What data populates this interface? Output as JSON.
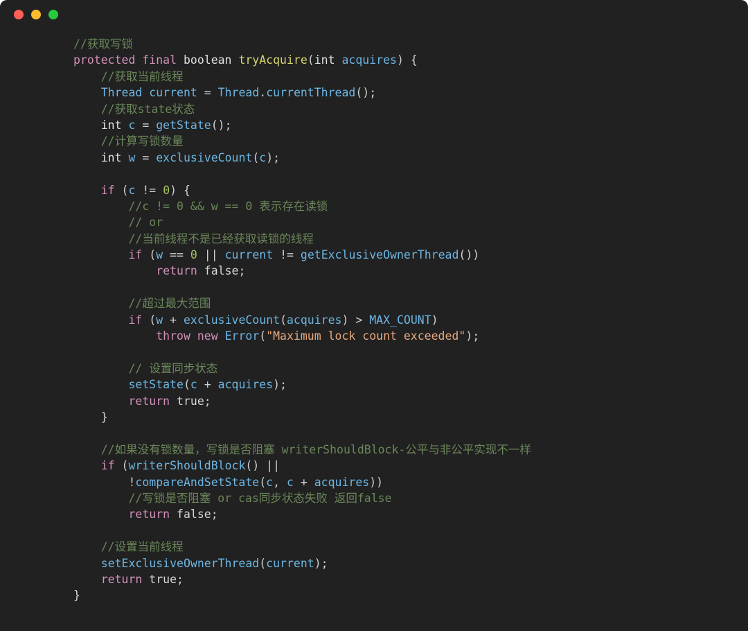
{
  "window": {
    "background": "#212121",
    "controls": [
      {
        "name": "close",
        "color": "#ff5f56"
      },
      {
        "name": "minimize",
        "color": "#ffbd2e"
      },
      {
        "name": "maximize",
        "color": "#27c93f"
      }
    ]
  },
  "theme": {
    "comment": "#6a8759",
    "keyword": "#d291bc",
    "type": "#e0e0e0",
    "function": "#d6d66e",
    "identifier": "#6cb6e3",
    "plain": "#d6d6d6",
    "number": "#a5c261",
    "string": "#e8a87c"
  },
  "code": {
    "language": "java",
    "plain_text": "//获取写锁\nprotected final boolean tryAcquire(int acquires) {\n    //获取当前线程\n    Thread current = Thread.currentThread();\n    //获取state状态\n    int c = getState();\n    //计算写锁数量\n    int w = exclusiveCount(c);\n\n    if (c != 0) {\n        //c != 0 && w == 0 表示存在读锁\n        // or\n        //当前线程不是已经获取读锁的线程\n        if (w == 0 || current != getExclusiveOwnerThread())\n            return false;\n\n        //超过最大范围\n        if (w + exclusiveCount(acquires) > MAX_COUNT)\n            throw new Error(\"Maximum lock count exceeded\");\n\n        // 设置同步状态\n        setState(c + acquires);\n        return true;\n    }\n\n    //如果没有锁数量，写锁是否阻塞 writerShouldBlock-公平与非公平实现不一样\n    if (writerShouldBlock() ||\n        !compareAndSetState(c, c + acquires))\n        //写锁是否阻塞 or cas同步状态失败 返回false\n        return false;\n\n    //设置当前线程\n    setExclusiveOwnerThread(current);\n    return true;\n}",
    "lines": [
      [
        {
          "t": "com",
          "v": "//获取写锁"
        }
      ],
      [
        {
          "t": "kw",
          "v": "protected"
        },
        {
          "t": "plain",
          "v": " "
        },
        {
          "t": "kw",
          "v": "final"
        },
        {
          "t": "plain",
          "v": " "
        },
        {
          "t": "type",
          "v": "boolean"
        },
        {
          "t": "plain",
          "v": " "
        },
        {
          "t": "fn",
          "v": "tryAcquire"
        },
        {
          "t": "punc",
          "v": "("
        },
        {
          "t": "type",
          "v": "int"
        },
        {
          "t": "plain",
          "v": " "
        },
        {
          "t": "id",
          "v": "acquires"
        },
        {
          "t": "punc",
          "v": ") {"
        }
      ],
      [
        {
          "t": "plain",
          "v": "    "
        },
        {
          "t": "com",
          "v": "//获取当前线程"
        }
      ],
      [
        {
          "t": "plain",
          "v": "    "
        },
        {
          "t": "cls",
          "v": "Thread"
        },
        {
          "t": "plain",
          "v": " "
        },
        {
          "t": "id",
          "v": "current"
        },
        {
          "t": "punc",
          "v": " = "
        },
        {
          "t": "cls",
          "v": "Thread"
        },
        {
          "t": "punc",
          "v": "."
        },
        {
          "t": "id",
          "v": "currentThread"
        },
        {
          "t": "punc",
          "v": "();"
        }
      ],
      [
        {
          "t": "plain",
          "v": "    "
        },
        {
          "t": "com",
          "v": "//获取state状态"
        }
      ],
      [
        {
          "t": "plain",
          "v": "    "
        },
        {
          "t": "type",
          "v": "int"
        },
        {
          "t": "plain",
          "v": " "
        },
        {
          "t": "id",
          "v": "c"
        },
        {
          "t": "punc",
          "v": " = "
        },
        {
          "t": "id",
          "v": "getState"
        },
        {
          "t": "punc",
          "v": "();"
        }
      ],
      [
        {
          "t": "plain",
          "v": "    "
        },
        {
          "t": "com",
          "v": "//计算写锁数量"
        }
      ],
      [
        {
          "t": "plain",
          "v": "    "
        },
        {
          "t": "type",
          "v": "int"
        },
        {
          "t": "plain",
          "v": " "
        },
        {
          "t": "id",
          "v": "w"
        },
        {
          "t": "punc",
          "v": " = "
        },
        {
          "t": "id",
          "v": "exclusiveCount"
        },
        {
          "t": "punc",
          "v": "("
        },
        {
          "t": "id",
          "v": "c"
        },
        {
          "t": "punc",
          "v": ");"
        }
      ],
      [],
      [
        {
          "t": "plain",
          "v": "    "
        },
        {
          "t": "kw",
          "v": "if"
        },
        {
          "t": "punc",
          "v": " ("
        },
        {
          "t": "id",
          "v": "c"
        },
        {
          "t": "punc",
          "v": " != "
        },
        {
          "t": "num",
          "v": "0"
        },
        {
          "t": "punc",
          "v": ") {"
        }
      ],
      [
        {
          "t": "plain",
          "v": "        "
        },
        {
          "t": "com",
          "v": "//c != 0 && w == 0 表示存在读锁"
        }
      ],
      [
        {
          "t": "plain",
          "v": "        "
        },
        {
          "t": "com",
          "v": "// or"
        }
      ],
      [
        {
          "t": "plain",
          "v": "        "
        },
        {
          "t": "com",
          "v": "//当前线程不是已经获取读锁的线程"
        }
      ],
      [
        {
          "t": "plain",
          "v": "        "
        },
        {
          "t": "kw",
          "v": "if"
        },
        {
          "t": "punc",
          "v": " ("
        },
        {
          "t": "id",
          "v": "w"
        },
        {
          "t": "punc",
          "v": " == "
        },
        {
          "t": "num",
          "v": "0"
        },
        {
          "t": "punc",
          "v": " || "
        },
        {
          "t": "id",
          "v": "current"
        },
        {
          "t": "punc",
          "v": " != "
        },
        {
          "t": "id",
          "v": "getExclusiveOwnerThread"
        },
        {
          "t": "punc",
          "v": "())"
        }
      ],
      [
        {
          "t": "plain",
          "v": "            "
        },
        {
          "t": "kw",
          "v": "return"
        },
        {
          "t": "plain",
          "v": " "
        },
        {
          "t": "plain",
          "v": "false"
        },
        {
          "t": "punc",
          "v": ";"
        }
      ],
      [],
      [
        {
          "t": "plain",
          "v": "        "
        },
        {
          "t": "com",
          "v": "//超过最大范围"
        }
      ],
      [
        {
          "t": "plain",
          "v": "        "
        },
        {
          "t": "kw",
          "v": "if"
        },
        {
          "t": "punc",
          "v": " ("
        },
        {
          "t": "id",
          "v": "w"
        },
        {
          "t": "punc",
          "v": " + "
        },
        {
          "t": "id",
          "v": "exclusiveCount"
        },
        {
          "t": "punc",
          "v": "("
        },
        {
          "t": "id",
          "v": "acquires"
        },
        {
          "t": "punc",
          "v": ") > "
        },
        {
          "t": "id",
          "v": "MAX_COUNT"
        },
        {
          "t": "punc",
          "v": ")"
        }
      ],
      [
        {
          "t": "plain",
          "v": "            "
        },
        {
          "t": "kw",
          "v": "throw"
        },
        {
          "t": "plain",
          "v": " "
        },
        {
          "t": "kw",
          "v": "new"
        },
        {
          "t": "plain",
          "v": " "
        },
        {
          "t": "cls",
          "v": "Error"
        },
        {
          "t": "punc",
          "v": "("
        },
        {
          "t": "str",
          "v": "\"Maximum lock count exceeded\""
        },
        {
          "t": "punc",
          "v": ");"
        }
      ],
      [],
      [
        {
          "t": "plain",
          "v": "        "
        },
        {
          "t": "com",
          "v": "// 设置同步状态"
        }
      ],
      [
        {
          "t": "plain",
          "v": "        "
        },
        {
          "t": "id",
          "v": "setState"
        },
        {
          "t": "punc",
          "v": "("
        },
        {
          "t": "id",
          "v": "c"
        },
        {
          "t": "punc",
          "v": " + "
        },
        {
          "t": "id",
          "v": "acquires"
        },
        {
          "t": "punc",
          "v": ");"
        }
      ],
      [
        {
          "t": "plain",
          "v": "        "
        },
        {
          "t": "kw",
          "v": "return"
        },
        {
          "t": "plain",
          "v": " "
        },
        {
          "t": "plain",
          "v": "true"
        },
        {
          "t": "punc",
          "v": ";"
        }
      ],
      [
        {
          "t": "plain",
          "v": "    "
        },
        {
          "t": "punc",
          "v": "}"
        }
      ],
      [],
      [
        {
          "t": "plain",
          "v": "    "
        },
        {
          "t": "com",
          "v": "//如果没有锁数量，写锁是否阻塞 writerShouldBlock-公平与非公平实现不一样"
        }
      ],
      [
        {
          "t": "plain",
          "v": "    "
        },
        {
          "t": "kw",
          "v": "if"
        },
        {
          "t": "punc",
          "v": " ("
        },
        {
          "t": "id",
          "v": "writerShouldBlock"
        },
        {
          "t": "punc",
          "v": "() ||"
        }
      ],
      [
        {
          "t": "plain",
          "v": "        "
        },
        {
          "t": "punc",
          "v": "!"
        },
        {
          "t": "id",
          "v": "compareAndSetState"
        },
        {
          "t": "punc",
          "v": "("
        },
        {
          "t": "id",
          "v": "c"
        },
        {
          "t": "punc",
          "v": ", "
        },
        {
          "t": "id",
          "v": "c"
        },
        {
          "t": "punc",
          "v": " + "
        },
        {
          "t": "id",
          "v": "acquires"
        },
        {
          "t": "punc",
          "v": "))"
        }
      ],
      [
        {
          "t": "plain",
          "v": "        "
        },
        {
          "t": "com",
          "v": "//写锁是否阻塞 or cas同步状态失败 返回false"
        }
      ],
      [
        {
          "t": "plain",
          "v": "        "
        },
        {
          "t": "kw",
          "v": "return"
        },
        {
          "t": "plain",
          "v": " "
        },
        {
          "t": "plain",
          "v": "false"
        },
        {
          "t": "punc",
          "v": ";"
        }
      ],
      [],
      [
        {
          "t": "plain",
          "v": "    "
        },
        {
          "t": "com",
          "v": "//设置当前线程"
        }
      ],
      [
        {
          "t": "plain",
          "v": "    "
        },
        {
          "t": "id",
          "v": "setExclusiveOwnerThread"
        },
        {
          "t": "punc",
          "v": "("
        },
        {
          "t": "id",
          "v": "current"
        },
        {
          "t": "punc",
          "v": ");"
        }
      ],
      [
        {
          "t": "plain",
          "v": "    "
        },
        {
          "t": "kw",
          "v": "return"
        },
        {
          "t": "plain",
          "v": " "
        },
        {
          "t": "plain",
          "v": "true"
        },
        {
          "t": "punc",
          "v": ";"
        }
      ],
      [
        {
          "t": "plain",
          "v": "}"
        }
      ]
    ]
  }
}
